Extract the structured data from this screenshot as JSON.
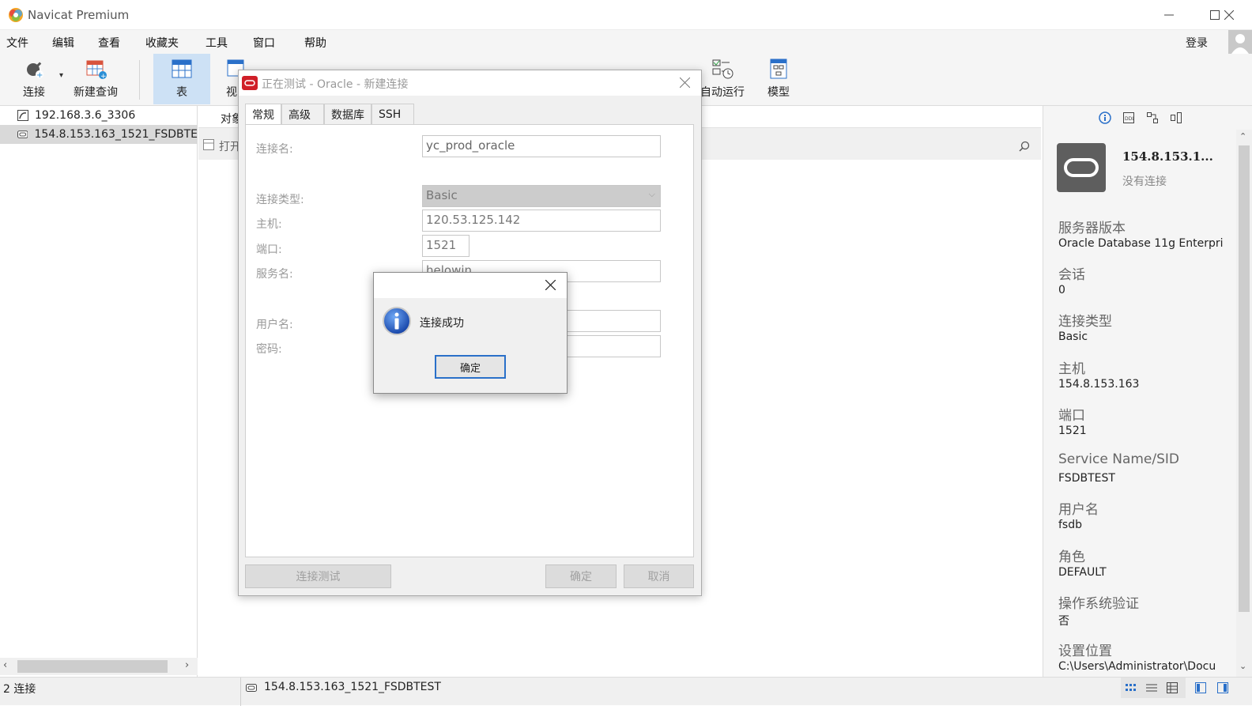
{
  "app": {
    "title": "Navicat Premium",
    "login": "登录"
  },
  "menu": [
    "文件",
    "编辑",
    "查看",
    "收藏夹",
    "工具",
    "窗口",
    "帮助"
  ],
  "toolbar": {
    "connect": "连接",
    "new_query": "新建查询",
    "table": "表",
    "view_partial": "视",
    "auto_run_partial": "自动运行",
    "model": "模型"
  },
  "connections": [
    "192.168.3.6_3306",
    "154.8.153.163_1521_FSDBTE"
  ],
  "center": {
    "objects_tab_partial": "对象",
    "open_partial": "打开"
  },
  "info_panel": {
    "conn_name": "154.8.153.1...",
    "conn_status": "没有连接",
    "fields": [
      {
        "label": "服务器版本",
        "value": "Oracle Database 11g Enterpri"
      },
      {
        "label": "会话",
        "value": "0"
      },
      {
        "label": "连接类型",
        "value": "Basic"
      },
      {
        "label": "主机",
        "value": "154.8.153.163"
      },
      {
        "label": "端口",
        "value": "1521"
      },
      {
        "label": "Service Name/SID",
        "value": "FSDBTEST"
      },
      {
        "label": "用户名",
        "value": "fsdb"
      },
      {
        "label": "角色",
        "value": "DEFAULT"
      },
      {
        "label": "操作系统验证",
        "value": "否"
      },
      {
        "label": "设置位置",
        "value": "C:\\Users\\Administrator\\Docu"
      }
    ]
  },
  "status": {
    "connections": "2 连接",
    "active_conn": "154.8.153.163_1521_FSDBTEST"
  },
  "dialog": {
    "title": "正在测试 - Oracle - 新建连接",
    "tabs": [
      "常规",
      "高级",
      "数据库",
      "SSH"
    ],
    "labels": {
      "conn_name": "连接名:",
      "conn_type": "连接类型:",
      "host": "主机:",
      "port": "端口:",
      "service": "服务名:",
      "user": "用户名:",
      "password": "密码:"
    },
    "values": {
      "conn_name": "yc_prod_oracle",
      "conn_type": "Basic",
      "host": "120.53.125.142",
      "port": "1521",
      "service": "helowin"
    },
    "buttons": {
      "test": "连接测试",
      "ok": "确定",
      "cancel": "取消"
    }
  },
  "message": {
    "text": "连接成功",
    "ok": "确定"
  },
  "colors": {
    "accent": "#2a70c9",
    "selected_toolbar": "#cde1f5",
    "oracle_red": "#d01f28"
  }
}
